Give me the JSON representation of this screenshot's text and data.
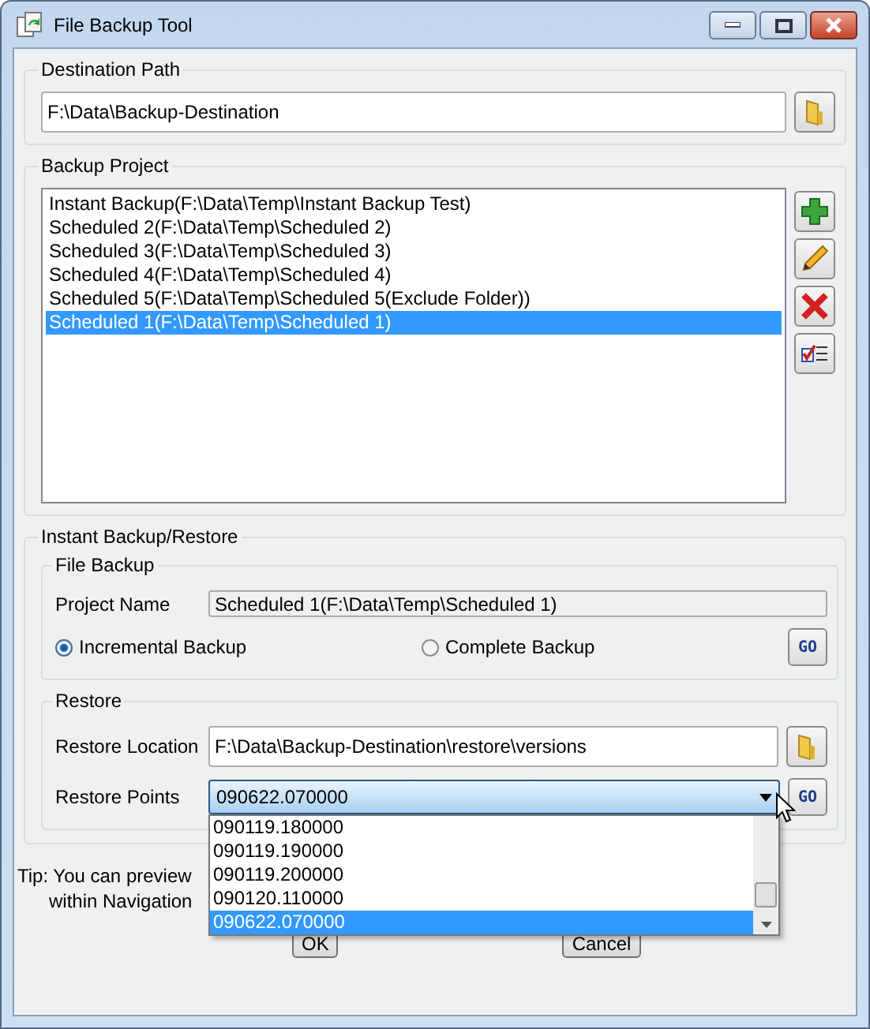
{
  "window": {
    "title": "File Backup Tool"
  },
  "destination": {
    "label": "Destination Path",
    "value": "F:\\Data\\Backup-Destination"
  },
  "backup_project": {
    "label": "Backup Project",
    "items": [
      {
        "text": "Instant Backup(F:\\Data\\Temp\\Instant Backup Test)",
        "selected": false
      },
      {
        "text": "Scheduled 2(F:\\Data\\Temp\\Scheduled 2)",
        "selected": false
      },
      {
        "text": "Scheduled 3(F:\\Data\\Temp\\Scheduled 3)",
        "selected": false
      },
      {
        "text": "Scheduled 4(F:\\Data\\Temp\\Scheduled 4)",
        "selected": false
      },
      {
        "text": "Scheduled 5(F:\\Data\\Temp\\Scheduled 5(Exclude Folder))",
        "selected": false
      },
      {
        "text": "Scheduled 1(F:\\Data\\Temp\\Scheduled 1)",
        "selected": true
      }
    ]
  },
  "instant": {
    "label": "Instant Backup/Restore",
    "file_backup": {
      "label": "File Backup",
      "project_name_label": "Project Name",
      "project_name": "Scheduled 1(F:\\Data\\Temp\\Scheduled 1)",
      "modes": [
        {
          "label": "Incremental Backup",
          "selected": true
        },
        {
          "label": "Complete Backup",
          "selected": false
        }
      ],
      "go": "GO"
    },
    "restore": {
      "label": "Restore",
      "location_label": "Restore Location",
      "location": "F:\\Data\\Backup-Destination\\restore\\versions",
      "points_label": "Restore Points",
      "points_value": "090622.070000",
      "expanded": true,
      "go": "GO",
      "options": [
        {
          "text": "090119.180000",
          "selected": false
        },
        {
          "text": "090119.190000",
          "selected": false
        },
        {
          "text": "090119.200000",
          "selected": false
        },
        {
          "text": "090120.110000",
          "selected": false
        },
        {
          "text": "090622.070000",
          "selected": true
        }
      ]
    }
  },
  "tip": [
    "Tip: You can preview",
    "within Navigation"
  ],
  "buttons": [
    "OK",
    "Cancel"
  ]
}
